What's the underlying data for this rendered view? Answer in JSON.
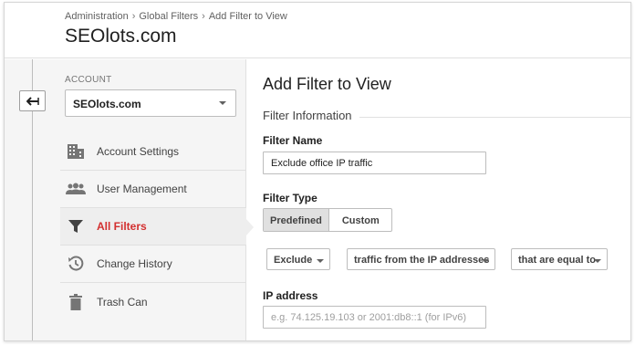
{
  "breadcrumb": {
    "items": [
      "Administration",
      "Global Filters",
      "Add Filter to View"
    ],
    "separator": "›"
  },
  "site": {
    "title": "SEOlots.com"
  },
  "left_panel": {
    "account_label": "ACCOUNT",
    "account_selected": "SEOlots.com",
    "back_icon": "back-arrow-icon",
    "nav": [
      {
        "label": "Account Settings",
        "icon": "building-icon",
        "active": false
      },
      {
        "label": "User Management",
        "icon": "users-icon",
        "active": false
      },
      {
        "label": "All Filters",
        "icon": "filter-icon",
        "active": true
      },
      {
        "label": "Change History",
        "icon": "history-icon",
        "active": false
      },
      {
        "label": "Trash Can",
        "icon": "trash-icon",
        "active": false
      }
    ]
  },
  "main": {
    "title": "Add Filter to View",
    "section": "Filter Information",
    "filter_name": {
      "label": "Filter Name",
      "value": "Exclude office IP traffic"
    },
    "filter_type": {
      "label": "Filter Type",
      "options": [
        "Predefined",
        "Custom"
      ],
      "selected": "Predefined"
    },
    "dropdowns": {
      "action": "Exclude",
      "source": "traffic from the IP addresses",
      "operator": "that are equal to"
    },
    "ip_address": {
      "label": "IP address",
      "placeholder": "e.g. 74.125.19.103 or 2001:db8::1 (for IPv6)"
    }
  },
  "colors": {
    "active_red": "#d32f2f",
    "icon_gray": "#757575",
    "panel_bg": "#f5f5f5"
  }
}
